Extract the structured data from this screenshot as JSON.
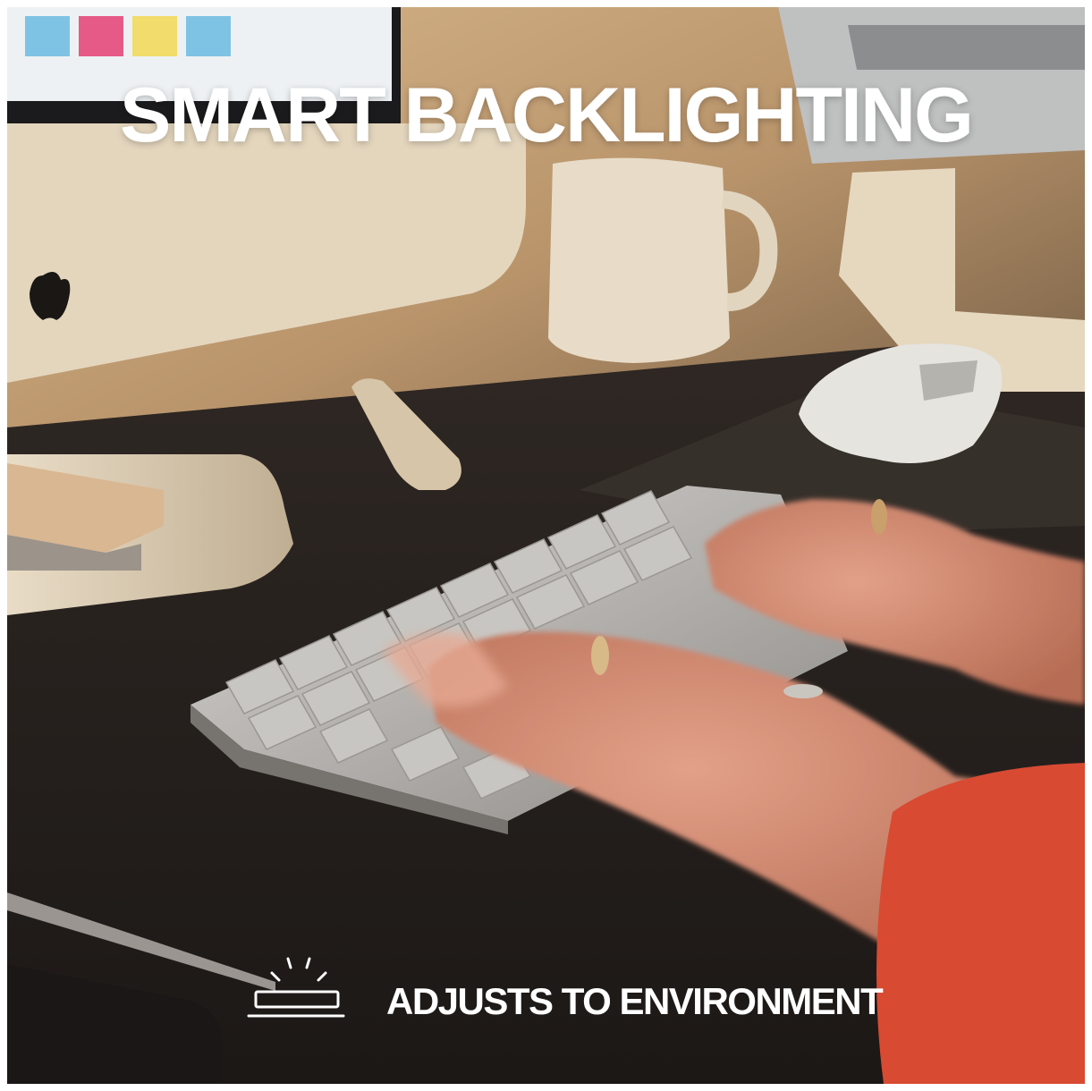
{
  "headline": "SMART BACKLIGHTING",
  "feature": {
    "icon": "backlit-key-icon",
    "text": "ADJUSTS TO ENVIRONMENT"
  },
  "colors": {
    "text": "#ffffff",
    "desk": "#231e1b",
    "wall": "#c9a77e",
    "sleeve": "#d84a32"
  }
}
